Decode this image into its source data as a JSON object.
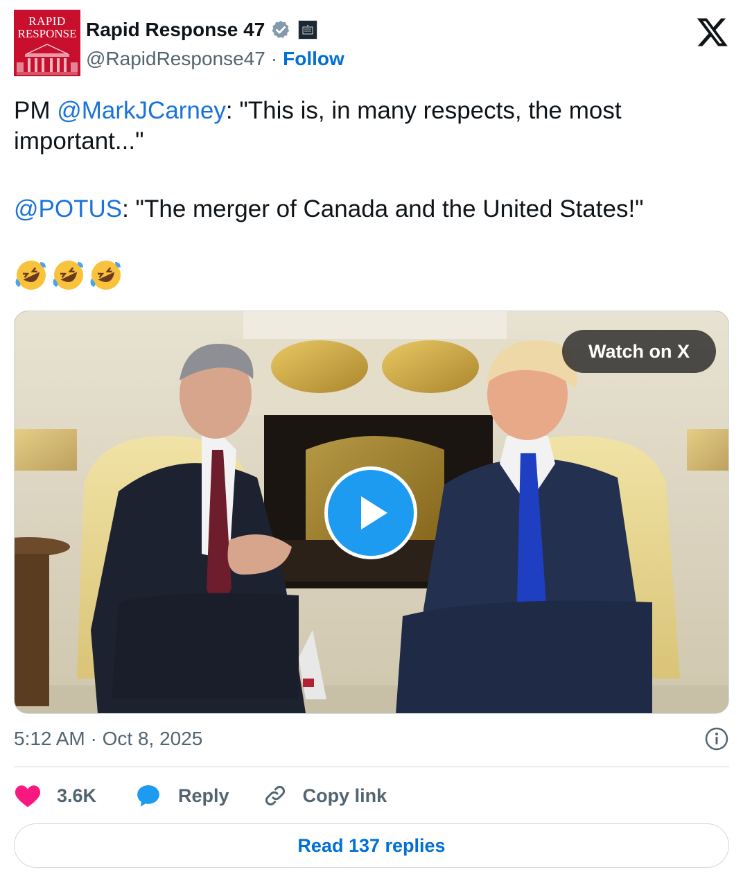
{
  "author": {
    "display_name": "Rapid Response 47",
    "handle": "@RapidResponse47",
    "separator": "·",
    "follow_label": "Follow",
    "avatar_line1": "RAPID",
    "avatar_line2": "RESPONSE",
    "avatar_color": "#c8102e",
    "verified_icon": "verified-badge-icon",
    "affiliation_icon": "white-house-affiliate-icon"
  },
  "platform_logo": "x-logo-icon",
  "tweet": {
    "line1_prefix": "PM ",
    "line1_mention": "@MarkJCarney",
    "line1_text": ": \"This is, in many respects, the most important...\"",
    "line2_mention": "@POTUS",
    "line2_text": ": \"The merger of Canada and the United States!\"",
    "emojis": [
      "🤣",
      "🤣",
      "🤣"
    ]
  },
  "media": {
    "watch_label": "Watch on X",
    "play_icon": "play-icon"
  },
  "timestamp": "5:12 AM · Oct 8, 2025",
  "actions": {
    "like_count": "3.6K",
    "reply_label": "Reply",
    "copy_label": "Copy link"
  },
  "read_replies_label": "Read 137 replies",
  "colors": {
    "link_blue": "#1a73d9",
    "follow_blue": "#006fd6",
    "like_pink": "#f91880",
    "reply_blue": "#1d9bf0",
    "muted_gray": "#536471"
  }
}
